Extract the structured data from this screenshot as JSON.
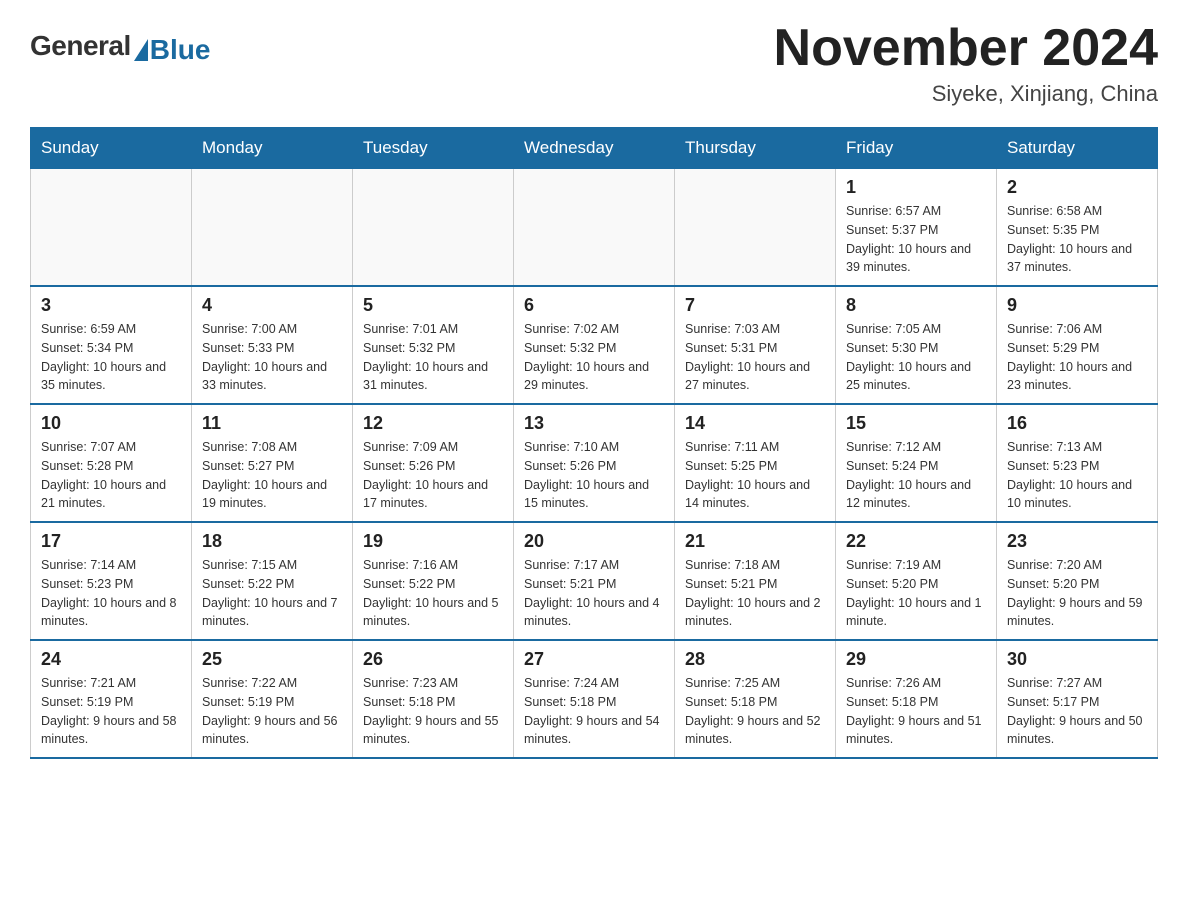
{
  "header": {
    "logo_general": "General",
    "logo_blue": "Blue",
    "month_title": "November 2024",
    "location": "Siyeke, Xinjiang, China"
  },
  "weekdays": [
    "Sunday",
    "Monday",
    "Tuesday",
    "Wednesday",
    "Thursday",
    "Friday",
    "Saturday"
  ],
  "weeks": [
    [
      {
        "day": "",
        "info": ""
      },
      {
        "day": "",
        "info": ""
      },
      {
        "day": "",
        "info": ""
      },
      {
        "day": "",
        "info": ""
      },
      {
        "day": "",
        "info": ""
      },
      {
        "day": "1",
        "info": "Sunrise: 6:57 AM\nSunset: 5:37 PM\nDaylight: 10 hours and 39 minutes."
      },
      {
        "day": "2",
        "info": "Sunrise: 6:58 AM\nSunset: 5:35 PM\nDaylight: 10 hours and 37 minutes."
      }
    ],
    [
      {
        "day": "3",
        "info": "Sunrise: 6:59 AM\nSunset: 5:34 PM\nDaylight: 10 hours and 35 minutes."
      },
      {
        "day": "4",
        "info": "Sunrise: 7:00 AM\nSunset: 5:33 PM\nDaylight: 10 hours and 33 minutes."
      },
      {
        "day": "5",
        "info": "Sunrise: 7:01 AM\nSunset: 5:32 PM\nDaylight: 10 hours and 31 minutes."
      },
      {
        "day": "6",
        "info": "Sunrise: 7:02 AM\nSunset: 5:32 PM\nDaylight: 10 hours and 29 minutes."
      },
      {
        "day": "7",
        "info": "Sunrise: 7:03 AM\nSunset: 5:31 PM\nDaylight: 10 hours and 27 minutes."
      },
      {
        "day": "8",
        "info": "Sunrise: 7:05 AM\nSunset: 5:30 PM\nDaylight: 10 hours and 25 minutes."
      },
      {
        "day": "9",
        "info": "Sunrise: 7:06 AM\nSunset: 5:29 PM\nDaylight: 10 hours and 23 minutes."
      }
    ],
    [
      {
        "day": "10",
        "info": "Sunrise: 7:07 AM\nSunset: 5:28 PM\nDaylight: 10 hours and 21 minutes."
      },
      {
        "day": "11",
        "info": "Sunrise: 7:08 AM\nSunset: 5:27 PM\nDaylight: 10 hours and 19 minutes."
      },
      {
        "day": "12",
        "info": "Sunrise: 7:09 AM\nSunset: 5:26 PM\nDaylight: 10 hours and 17 minutes."
      },
      {
        "day": "13",
        "info": "Sunrise: 7:10 AM\nSunset: 5:26 PM\nDaylight: 10 hours and 15 minutes."
      },
      {
        "day": "14",
        "info": "Sunrise: 7:11 AM\nSunset: 5:25 PM\nDaylight: 10 hours and 14 minutes."
      },
      {
        "day": "15",
        "info": "Sunrise: 7:12 AM\nSunset: 5:24 PM\nDaylight: 10 hours and 12 minutes."
      },
      {
        "day": "16",
        "info": "Sunrise: 7:13 AM\nSunset: 5:23 PM\nDaylight: 10 hours and 10 minutes."
      }
    ],
    [
      {
        "day": "17",
        "info": "Sunrise: 7:14 AM\nSunset: 5:23 PM\nDaylight: 10 hours and 8 minutes."
      },
      {
        "day": "18",
        "info": "Sunrise: 7:15 AM\nSunset: 5:22 PM\nDaylight: 10 hours and 7 minutes."
      },
      {
        "day": "19",
        "info": "Sunrise: 7:16 AM\nSunset: 5:22 PM\nDaylight: 10 hours and 5 minutes."
      },
      {
        "day": "20",
        "info": "Sunrise: 7:17 AM\nSunset: 5:21 PM\nDaylight: 10 hours and 4 minutes."
      },
      {
        "day": "21",
        "info": "Sunrise: 7:18 AM\nSunset: 5:21 PM\nDaylight: 10 hours and 2 minutes."
      },
      {
        "day": "22",
        "info": "Sunrise: 7:19 AM\nSunset: 5:20 PM\nDaylight: 10 hours and 1 minute."
      },
      {
        "day": "23",
        "info": "Sunrise: 7:20 AM\nSunset: 5:20 PM\nDaylight: 9 hours and 59 minutes."
      }
    ],
    [
      {
        "day": "24",
        "info": "Sunrise: 7:21 AM\nSunset: 5:19 PM\nDaylight: 9 hours and 58 minutes."
      },
      {
        "day": "25",
        "info": "Sunrise: 7:22 AM\nSunset: 5:19 PM\nDaylight: 9 hours and 56 minutes."
      },
      {
        "day": "26",
        "info": "Sunrise: 7:23 AM\nSunset: 5:18 PM\nDaylight: 9 hours and 55 minutes."
      },
      {
        "day": "27",
        "info": "Sunrise: 7:24 AM\nSunset: 5:18 PM\nDaylight: 9 hours and 54 minutes."
      },
      {
        "day": "28",
        "info": "Sunrise: 7:25 AM\nSunset: 5:18 PM\nDaylight: 9 hours and 52 minutes."
      },
      {
        "day": "29",
        "info": "Sunrise: 7:26 AM\nSunset: 5:18 PM\nDaylight: 9 hours and 51 minutes."
      },
      {
        "day": "30",
        "info": "Sunrise: 7:27 AM\nSunset: 5:17 PM\nDaylight: 9 hours and 50 minutes."
      }
    ]
  ]
}
